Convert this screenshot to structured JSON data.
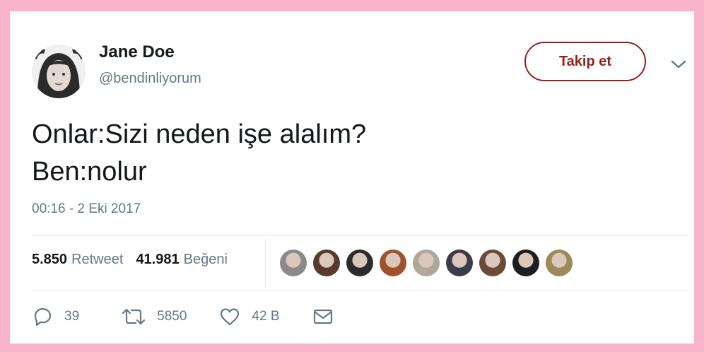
{
  "author": {
    "name": "Jane Doe",
    "handle": "@bendinliyorum"
  },
  "follow_label": "Takip et",
  "tweet": {
    "lines": [
      "Onlar:Sizi neden işe alalım?",
      "Ben:nolur"
    ]
  },
  "timestamp": "00:16 - 2 Eki 2017",
  "stats": {
    "retweets_count": "5.850",
    "retweets_label": "Retweet",
    "likes_count": "41.981",
    "likes_label": "Beğeni"
  },
  "liker_avatars": [
    {
      "color": "#8a8a8a"
    },
    {
      "color": "#5a3a2e"
    },
    {
      "color": "#2c2c2c"
    },
    {
      "color": "#a0522d"
    },
    {
      "color": "#b0a79a"
    },
    {
      "color": "#3b3b4a"
    },
    {
      "color": "#6b4a3a"
    },
    {
      "color": "#1e1e1e"
    },
    {
      "color": "#9c8a5a"
    }
  ],
  "actions": {
    "reply_count": "39",
    "retweet_count": "5850",
    "like_count": "42 B"
  },
  "icons": {
    "reply": "reply-icon",
    "retweet": "retweet-icon",
    "like": "heart-icon",
    "dm": "envelope-icon",
    "more": "chevron-down-icon"
  },
  "colors": {
    "frame": "#f9b4cc",
    "follow": "#9b1c1c",
    "muted": "#657786"
  }
}
